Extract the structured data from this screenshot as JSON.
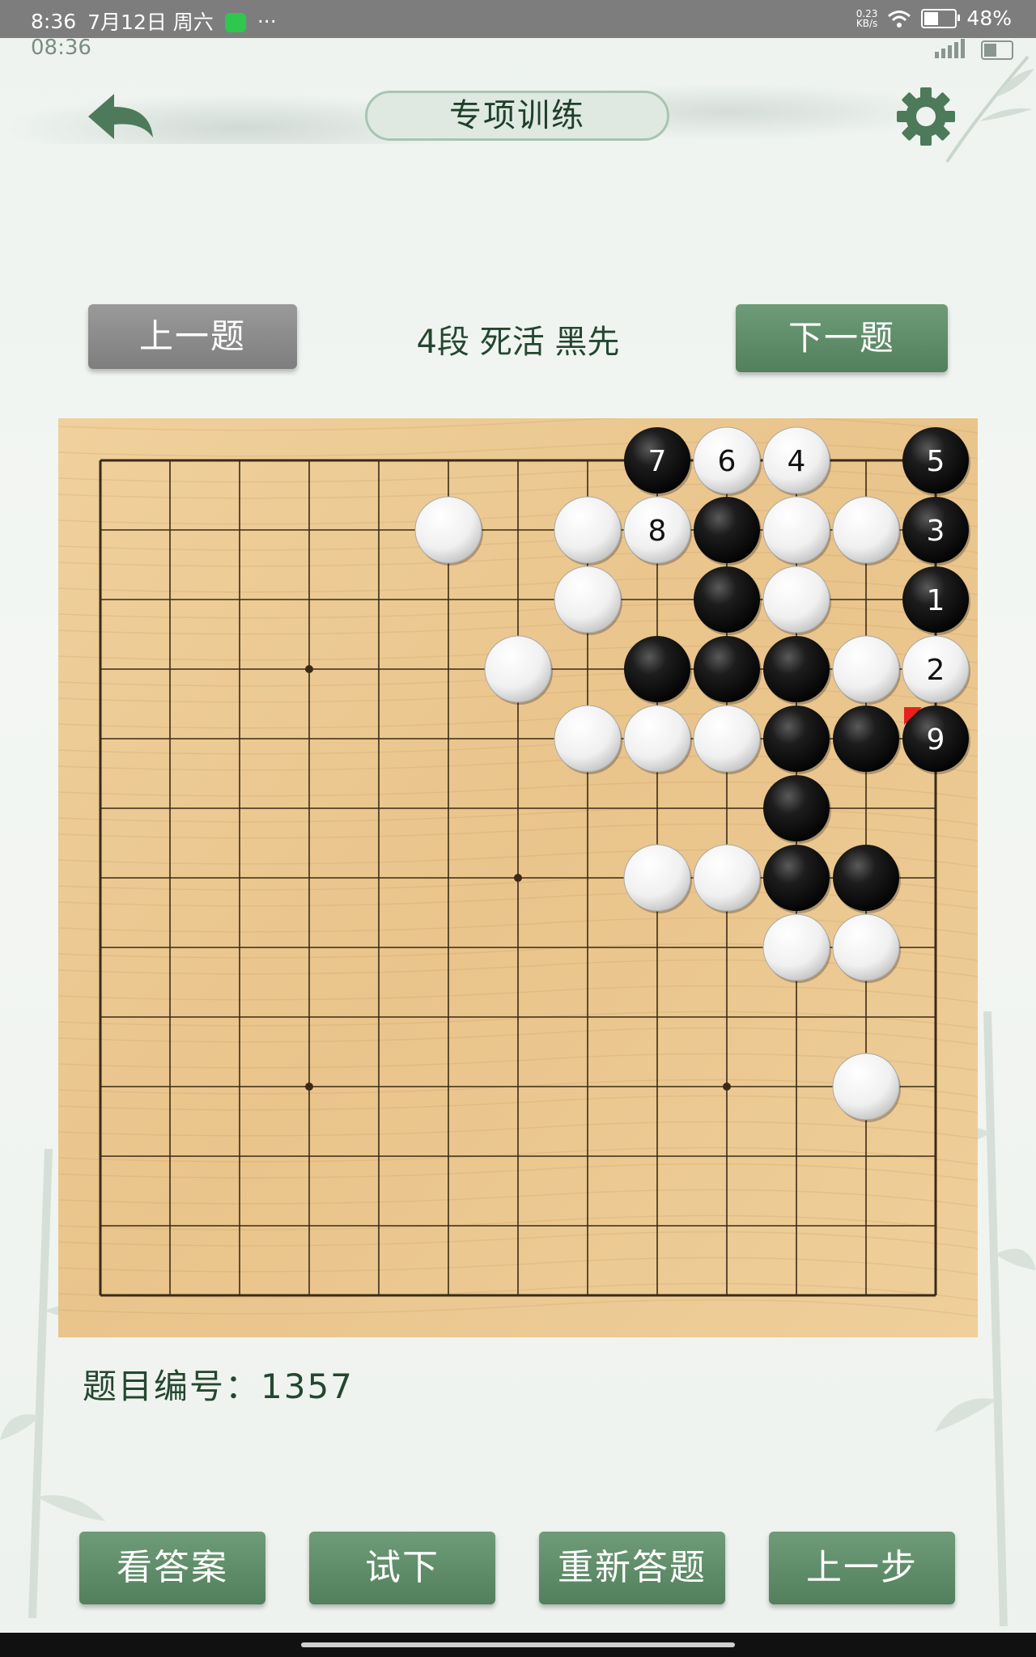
{
  "status_bar": {
    "time": "8:36",
    "date": "7月12日 周六",
    "more": "···",
    "net_speed_value": "0.23",
    "net_speed_unit": "KB/s",
    "battery": "48%",
    "battery_level": 0.48
  },
  "overlay_clock": "08:36",
  "header": {
    "title": "专项训练"
  },
  "nav": {
    "prev_label": "上一题",
    "next_label": "下一题",
    "level_text": "4段 死活 黑先"
  },
  "board": {
    "size": 13,
    "star_points": [
      [
        3,
        3
      ],
      [
        9,
        3
      ],
      [
        6,
        6
      ],
      [
        3,
        9
      ],
      [
        9,
        9
      ]
    ],
    "last_move_marker": "9",
    "stones": [
      {
        "col": 8,
        "row": 0,
        "color": "black",
        "label": "7"
      },
      {
        "col": 9,
        "row": 0,
        "color": "white",
        "label": "6"
      },
      {
        "col": 10,
        "row": 0,
        "color": "white",
        "label": "4"
      },
      {
        "col": 12,
        "row": 0,
        "color": "black",
        "label": "5"
      },
      {
        "col": 5,
        "row": 1,
        "color": "white",
        "label": ""
      },
      {
        "col": 7,
        "row": 1,
        "color": "white",
        "label": ""
      },
      {
        "col": 8,
        "row": 1,
        "color": "white",
        "label": "8"
      },
      {
        "col": 9,
        "row": 1,
        "color": "black",
        "label": ""
      },
      {
        "col": 10,
        "row": 1,
        "color": "white",
        "label": ""
      },
      {
        "col": 11,
        "row": 1,
        "color": "white",
        "label": ""
      },
      {
        "col": 12,
        "row": 1,
        "color": "black",
        "label": "3"
      },
      {
        "col": 7,
        "row": 2,
        "color": "white",
        "label": ""
      },
      {
        "col": 9,
        "row": 2,
        "color": "black",
        "label": ""
      },
      {
        "col": 10,
        "row": 2,
        "color": "white",
        "label": ""
      },
      {
        "col": 12,
        "row": 2,
        "color": "black",
        "label": "1"
      },
      {
        "col": 6,
        "row": 3,
        "color": "white",
        "label": ""
      },
      {
        "col": 8,
        "row": 3,
        "color": "black",
        "label": ""
      },
      {
        "col": 9,
        "row": 3,
        "color": "black",
        "label": ""
      },
      {
        "col": 10,
        "row": 3,
        "color": "black",
        "label": ""
      },
      {
        "col": 11,
        "row": 3,
        "color": "white",
        "label": ""
      },
      {
        "col": 12,
        "row": 3,
        "color": "white",
        "label": "2"
      },
      {
        "col": 7,
        "row": 4,
        "color": "white",
        "label": ""
      },
      {
        "col": 8,
        "row": 4,
        "color": "white",
        "label": ""
      },
      {
        "col": 9,
        "row": 4,
        "color": "white",
        "label": ""
      },
      {
        "col": 10,
        "row": 4,
        "color": "black",
        "label": ""
      },
      {
        "col": 11,
        "row": 4,
        "color": "black",
        "label": ""
      },
      {
        "col": 12,
        "row": 4,
        "color": "black",
        "label": "9"
      },
      {
        "col": 10,
        "row": 5,
        "color": "black",
        "label": ""
      },
      {
        "col": 8,
        "row": 6,
        "color": "white",
        "label": ""
      },
      {
        "col": 9,
        "row": 6,
        "color": "white",
        "label": ""
      },
      {
        "col": 10,
        "row": 6,
        "color": "black",
        "label": ""
      },
      {
        "col": 11,
        "row": 6,
        "color": "black",
        "label": ""
      },
      {
        "col": 10,
        "row": 7,
        "color": "white",
        "label": ""
      },
      {
        "col": 11,
        "row": 7,
        "color": "white",
        "label": ""
      },
      {
        "col": 11,
        "row": 9,
        "color": "white",
        "label": ""
      }
    ]
  },
  "puzzle_number": "题目编号：1357",
  "actions": {
    "view_answer": "看答案",
    "try": "试下",
    "restart": "重新答题",
    "undo": "上一步"
  },
  "colors": {
    "accent_green": "#5f8d69",
    "grey_button": "#8a8a8a",
    "board_wood": "#e8c48c",
    "last_move_marker": "#e82020"
  }
}
